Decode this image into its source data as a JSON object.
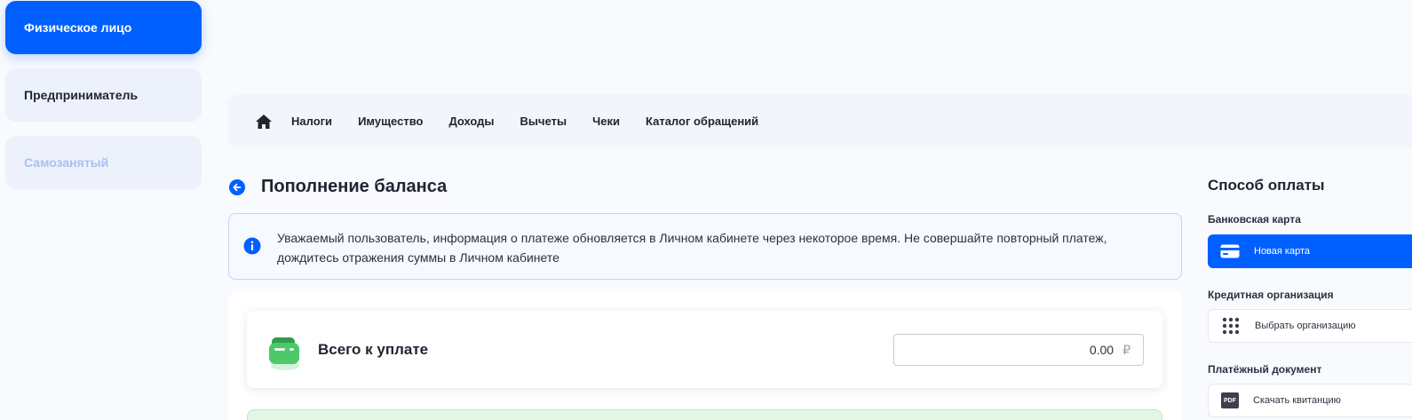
{
  "roles": {
    "individual": "Физическое лицо",
    "entrepreneur": "Предприниматель",
    "self_employed": "Самозанятый"
  },
  "nav": {
    "home_icon": "home-icon",
    "items": [
      "Налоги",
      "Имущество",
      "Доходы",
      "Вычеты",
      "Чеки",
      "Каталог обращений"
    ]
  },
  "page": {
    "title": "Пополнение баланса",
    "info": "Уважаемый пользователь, информация о платеже обновляется в Личном кабинете через некоторое время. Не совершайте повторный платеж, дождитесь отражения суммы в Личном кабинете"
  },
  "total": {
    "label": "Всего к уплате",
    "amount": "0.00",
    "currency": "₽"
  },
  "payment": {
    "title": "Способ оплаты",
    "bank_card_section": "Банковская карта",
    "new_card": "Новая карта",
    "credit_org_section": "Кредитная организация",
    "choose_org": "Выбрать организацию",
    "payment_doc_section": "Платёжный документ",
    "download_receipt": "Скачать квитанцию",
    "pdf_badge": "PDF"
  },
  "colors": {
    "accent": "#0060ff",
    "success_green": "#3dc45a"
  }
}
